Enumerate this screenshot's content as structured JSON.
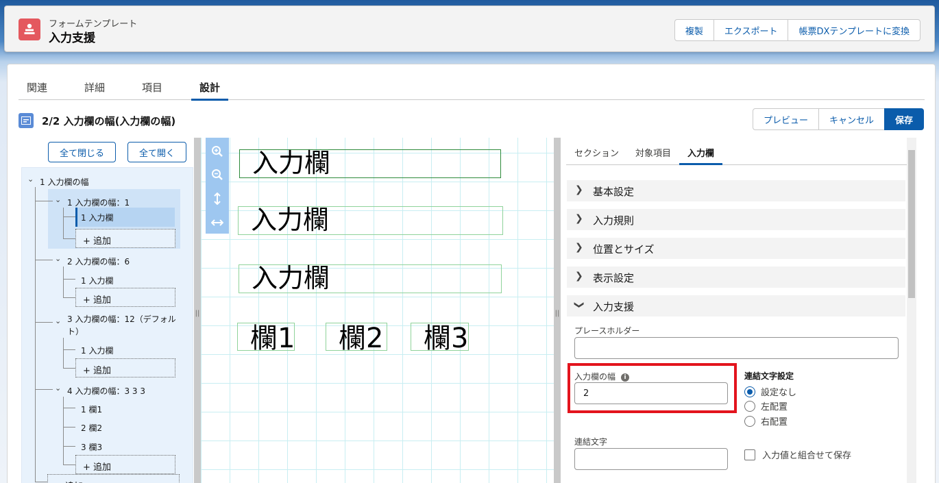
{
  "header": {
    "object_label": "フォームテンプレート",
    "record_title": "入力支援",
    "buttons": [
      "複製",
      "エクスポート",
      "帳票DXテンプレートに変換"
    ]
  },
  "tabs": [
    {
      "label": "関連",
      "active": false
    },
    {
      "label": "詳細",
      "active": false
    },
    {
      "label": "項目",
      "active": false
    },
    {
      "label": "設計",
      "active": true
    }
  ],
  "designer": {
    "title": "2/2 入力欄の幅(入力欄の幅)",
    "buttons": [
      "プレビュー",
      "キャンセル",
      "保存"
    ]
  },
  "tree": {
    "collapse_all": "全て閉じる",
    "expand_all": "全て開く",
    "root": "1 入力欄の幅",
    "groups": [
      {
        "label": "1 入力欄の幅：1",
        "items": [
          "1 入力欄"
        ],
        "add": "+ 追加"
      },
      {
        "label": "2 入力欄の幅：6",
        "items": [
          "1 入力欄"
        ],
        "add": "+ 追加"
      },
      {
        "label_line1": "3 入力欄の幅：12（デフォル",
        "label_line2": "ト）",
        "items": [
          "1 入力欄"
        ],
        "add": "+ 追加"
      },
      {
        "label": "4 入力欄の幅：3 3 3",
        "items": [
          "1 欄1",
          "2 欄2",
          "3 欄3"
        ],
        "add": "+ 追加"
      }
    ],
    "root_add": "+ 追加"
  },
  "canvas": {
    "fields": [
      "入力欄",
      "入力欄",
      "入力欄"
    ],
    "sub_fields": [
      "欄1",
      "欄2",
      "欄3"
    ],
    "tools": [
      "zoom-in-icon",
      "zoom-out-icon",
      "fit-height-icon",
      "fit-width-icon"
    ]
  },
  "properties": {
    "tabs": [
      {
        "label": "セクション",
        "active": false
      },
      {
        "label": "対象項目",
        "active": false
      },
      {
        "label": "入力欄",
        "active": true
      }
    ],
    "sections": [
      "基本設定",
      "入力規則",
      "位置とサイズ",
      "表示設定",
      "入力支援"
    ],
    "placeholder_label": "プレースホルダー",
    "placeholder_value": "",
    "width_label": "入力欄の幅",
    "width_value": "2",
    "join_setting_label": "連結文字設定",
    "join_options": [
      {
        "label": "設定なし",
        "selected": true
      },
      {
        "label": "左配置",
        "selected": false
      },
      {
        "label": "右配置",
        "selected": false
      }
    ],
    "join_char_label": "連結文字",
    "join_char_value": "",
    "save_combined_label": "入力値と組合せて保存",
    "save_combined_checked": false
  },
  "colors": {
    "brand": "#0b5cab",
    "highlight": "#e3141d",
    "object_icon": "#e4585e"
  }
}
